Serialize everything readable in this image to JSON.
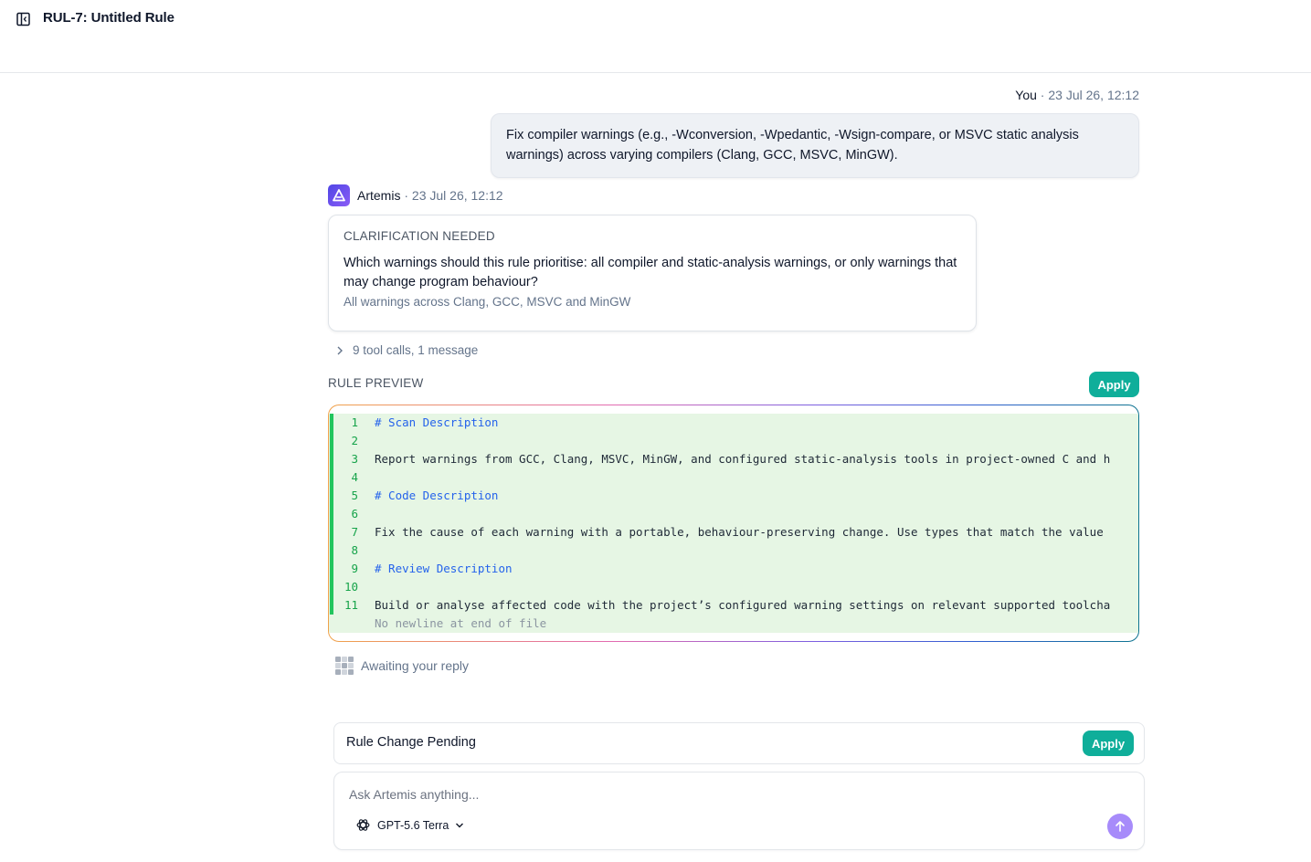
{
  "header": {
    "title": "RUL-7: Untitled Rule",
    "toggle_icon": "sidebar-collapse-icon"
  },
  "user_message": {
    "author": "You",
    "timestamp": "23 Jul 26, 12:12",
    "separator": "·",
    "text": "Fix compiler warnings (e.g., -Wconversion, -Wpedantic, -Wsign-compare, or MSVC static analysis warnings) across varying compilers (Clang, GCC, MSVC, MinGW)."
  },
  "assistant_message": {
    "author": "Artemis",
    "timestamp": "23 Jul 26, 12:12",
    "separator": "·",
    "avatar_icon": "artemis-logo-icon",
    "clarification": {
      "title": "CLARIFICATION NEEDED",
      "question": "Which warnings should this rule prioritise: all compiler and static-analysis warnings, or only warnings that may change program behaviour?",
      "answer": "All warnings across Clang, GCC, MSVC and MinGW"
    },
    "tool_calls_summary": "9 tool calls, 1 message"
  },
  "rule_preview": {
    "label": "RULE PREVIEW",
    "apply_label": "Apply",
    "lines": [
      {
        "n": "1",
        "text": "# Scan Description",
        "kind": "heading"
      },
      {
        "n": "2",
        "text": "",
        "kind": "text"
      },
      {
        "n": "3",
        "text": "Report warnings from GCC, Clang, MSVC, MinGW, and configured static-analysis tools in project-owned C and h",
        "kind": "text"
      },
      {
        "n": "4",
        "text": "",
        "kind": "text"
      },
      {
        "n": "5",
        "text": "# Code Description",
        "kind": "heading"
      },
      {
        "n": "6",
        "text": "",
        "kind": "text"
      },
      {
        "n": "7",
        "text": "Fix the cause of each warning with a portable, behaviour-preserving change. Use types that match the value",
        "kind": "text"
      },
      {
        "n": "8",
        "text": "",
        "kind": "text"
      },
      {
        "n": "9",
        "text": "# Review Description",
        "kind": "heading"
      },
      {
        "n": "10",
        "text": "",
        "kind": "text"
      },
      {
        "n": "11",
        "text": "Build or analyse affected code with the project’s configured warning settings on relevant supported toolcha",
        "kind": "text"
      },
      {
        "n": "",
        "text": "No newline at end of file",
        "kind": "note"
      }
    ]
  },
  "status": {
    "awaiting_text": "Awaiting your reply",
    "icon": "grid-loading-icon"
  },
  "pending": {
    "label": "Rule Change Pending",
    "apply_label": "Apply"
  },
  "composer": {
    "placeholder": "Ask Artemis anything...",
    "value": "",
    "model_name": "GPT-5.6 Terra",
    "model_icon": "openai-logo-icon",
    "send_icon": "arrow-up-icon"
  },
  "colors": {
    "accent_teal": "#0fae9a",
    "send_purple": "#a78bfa",
    "diff_added_bg": "#e6f6e4",
    "diff_stripe": "#22c55e",
    "heading_blue": "#2563eb"
  }
}
